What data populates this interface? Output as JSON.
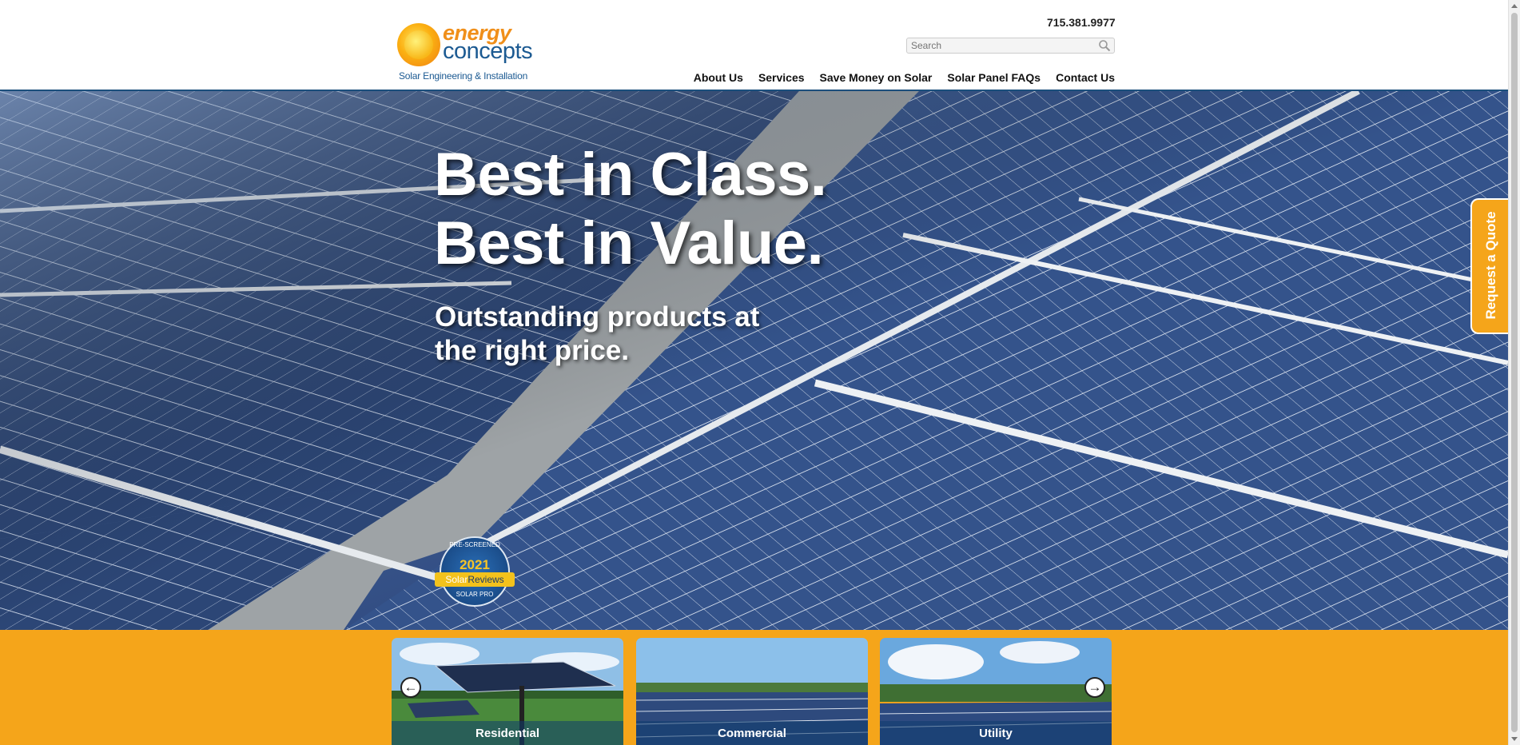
{
  "header": {
    "logo": {
      "word1": "energy",
      "word2": "concepts",
      "tagline": "Solar Engineering & Installation"
    },
    "phone": "715.381.9977",
    "search": {
      "placeholder": "Search",
      "value": ""
    },
    "nav": [
      "About Us",
      "Services",
      "Save Money on Solar",
      "Solar Panel FAQs",
      "Contact Us"
    ]
  },
  "hero": {
    "headline_line1": "Best in Class.",
    "headline_line2": "Best in Value.",
    "subline_line1": "Outstanding products at",
    "subline_line2": "the right price.",
    "badge": {
      "top": "PRE-SCREENED",
      "year": "2021",
      "brand_part1": "Solar",
      "brand_part2": "Reviews",
      "bottom": "SOLAR PRO"
    },
    "quote_tab": "Request a Quote"
  },
  "carousel": {
    "cards": [
      "Residential",
      "Commercial",
      "Utility"
    ],
    "prev_icon": "arrow-left-icon",
    "next_icon": "arrow-right-icon"
  },
  "colors": {
    "accent_orange": "#f5a51a",
    "brand_blue": "#1c5a92",
    "logo_orange": "#f08f1a"
  }
}
